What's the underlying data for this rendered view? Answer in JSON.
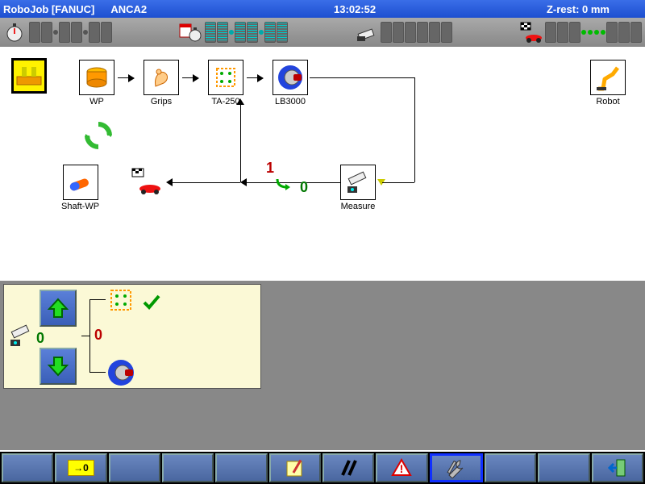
{
  "titlebar": {
    "app": "RoboJob [FANUC]",
    "profile": "ANCA2",
    "time": "13:02:52",
    "zrest": "Z-rest: 0 mm"
  },
  "flow": {
    "nodes": {
      "start": {
        "label": ""
      },
      "wp": {
        "label": "WP"
      },
      "grips": {
        "label": "Grips"
      },
      "ta250": {
        "label": "TA-250"
      },
      "lb3000": {
        "label": "LB3000"
      },
      "robot": {
        "label": "Robot"
      },
      "shaftwp": {
        "label": "Shaft-WP"
      },
      "measure": {
        "label": "Measure"
      }
    },
    "branch": {
      "top": "1",
      "bottom": "0"
    }
  },
  "panel": {
    "left_value": "0",
    "mid_value": "0"
  },
  "toolbar": {
    "home": "→0"
  }
}
